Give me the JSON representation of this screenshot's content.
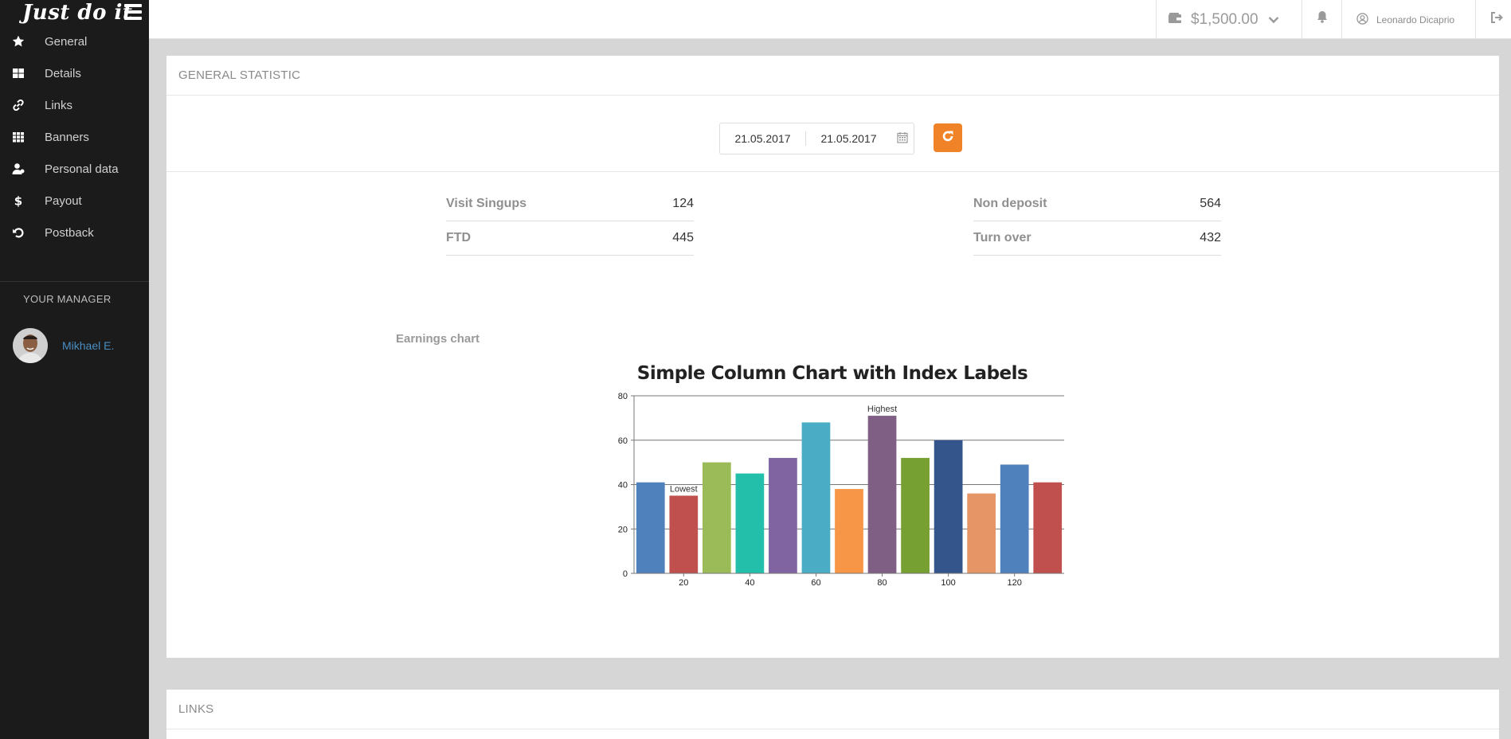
{
  "app": {
    "brand": "Just do it"
  },
  "sidebar": {
    "items": [
      {
        "label": "General",
        "icon": "star-icon"
      },
      {
        "label": "Details",
        "icon": "grid-icon"
      },
      {
        "label": "Links",
        "icon": "link-icon"
      },
      {
        "label": "Banners",
        "icon": "grid-large-icon"
      },
      {
        "label": "Personal data",
        "icon": "user-icon"
      },
      {
        "label": "Payout",
        "icon": "dollar-icon"
      },
      {
        "label": "Postback",
        "icon": "undo-icon"
      }
    ],
    "manager_title": "YOUR MANAGER",
    "manager_name": "Mikhael E."
  },
  "topbar": {
    "balance": "$1,500.00",
    "user_name": "Leonardo Dicaprio"
  },
  "stats_panel": {
    "title": "GENERAL STATISTIC",
    "date_from": "21.05.2017",
    "date_to": "21.05.2017",
    "left": [
      {
        "label": "Visit Singups",
        "value": "124"
      },
      {
        "label": "FTD",
        "value": "445"
      }
    ],
    "right": [
      {
        "label": "Non deposit",
        "value": "564"
      },
      {
        "label": "Turn over",
        "value": "432"
      }
    ],
    "earnings_title": "Earnings chart"
  },
  "links_panel": {
    "title": "LINKS"
  },
  "colors": {
    "accent": "#f08227",
    "sidebar_bg": "#1b1b1b",
    "link": "#4a8ec2"
  },
  "chart_data": {
    "type": "bar",
    "title": "Simple Column Chart with Index Labels",
    "x": [
      10,
      20,
      30,
      40,
      50,
      60,
      70,
      80,
      90,
      100,
      110,
      120,
      130
    ],
    "values": [
      41,
      35,
      50,
      45,
      52,
      68,
      38,
      71,
      52,
      60,
      36,
      49,
      41
    ],
    "colors": [
      "#4f81bc",
      "#c0504e",
      "#9bbb58",
      "#23bfaa",
      "#8064a1",
      "#4aacc5",
      "#f79647",
      "#7f6084",
      "#77a033",
      "#33558b",
      "#e59566",
      "#4f81bc",
      "#c0504e"
    ],
    "index_labels": [
      {
        "x": 20,
        "label": "Lowest"
      },
      {
        "x": 80,
        "label": "Highest"
      }
    ],
    "x_ticks": [
      20,
      40,
      60,
      80,
      100,
      120
    ],
    "y_ticks": [
      0,
      20,
      40,
      60,
      80
    ],
    "ylim": [
      0,
      80
    ],
    "xlabel": "",
    "ylabel": "",
    "grid": true
  }
}
